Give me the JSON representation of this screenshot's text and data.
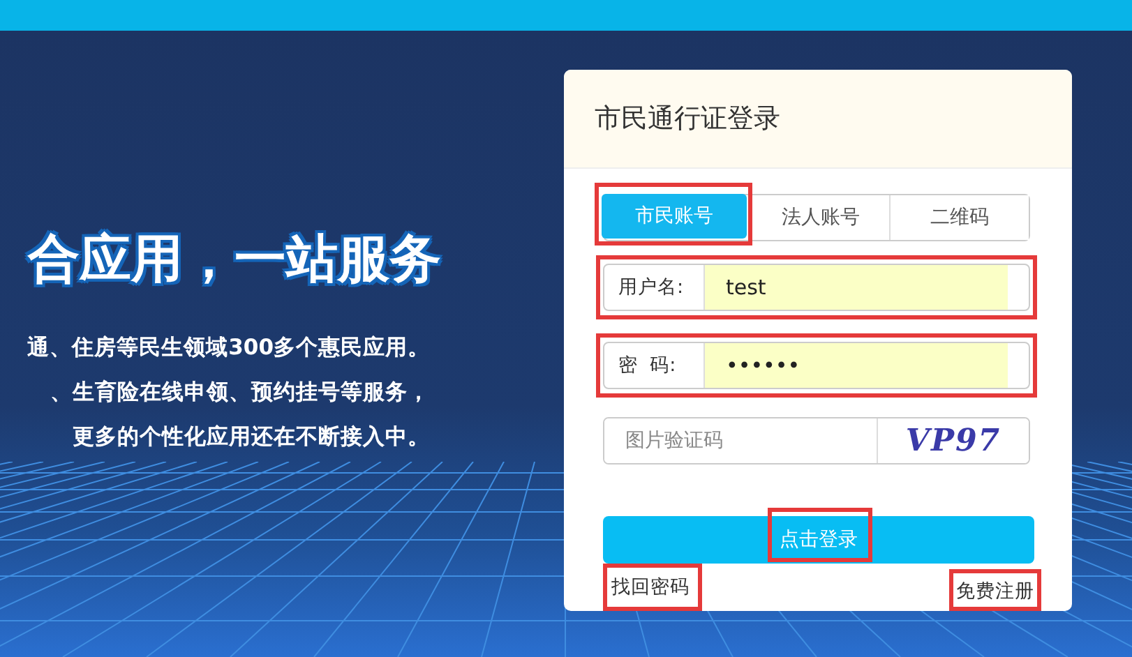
{
  "banner": {
    "headline": "合应用，一站服务",
    "lines": [
      "通、住房等民生领域300多个惠民应用。",
      "、生育险在线申领、预约挂号等服务，",
      "更多的个性化应用还在不断接入中。"
    ]
  },
  "login_panel": {
    "title": "市民通行证登录",
    "tabs": [
      {
        "label": "市民账号",
        "selected": true,
        "highlighted": true
      },
      {
        "label": "法人账号",
        "selected": false,
        "highlighted": false
      },
      {
        "label": "二维码",
        "selected": false,
        "highlighted": false
      }
    ],
    "fields": [
      {
        "kind": "labeled",
        "label": "用户名:",
        "value": "test",
        "highlighted": true
      },
      {
        "kind": "labeled",
        "label": "密  码:",
        "value": "••••••",
        "highlighted": true
      },
      {
        "kind": "captcha",
        "placeholder": "图片验证码",
        "captcha_text": "VP97",
        "highlighted": false
      }
    ],
    "login_button": {
      "label": "点击登录",
      "highlighted": true
    },
    "links": [
      {
        "label": "找回密码",
        "highlighted": true
      },
      {
        "label": "免费注册",
        "highlighted": true
      }
    ]
  }
}
